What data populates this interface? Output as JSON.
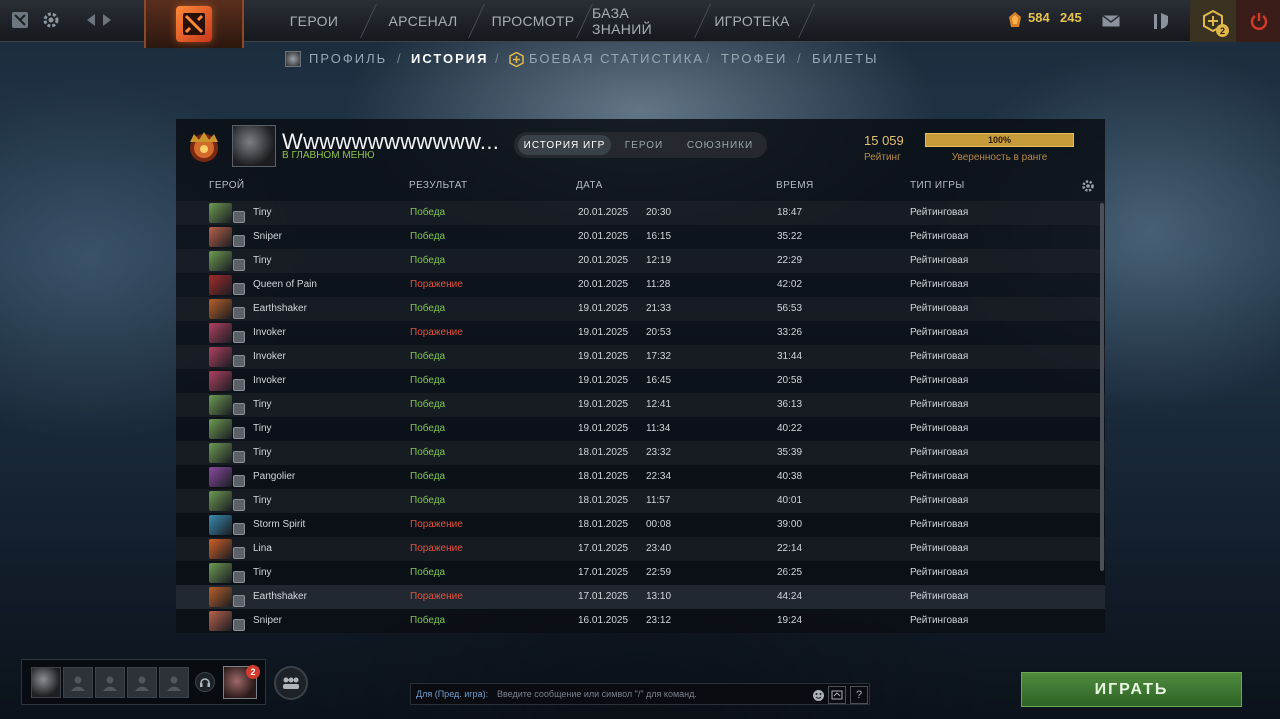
{
  "topbar": {
    "nav": [
      "ГЕРОИ",
      "АРСЕНАЛ",
      "ПРОСМОТР",
      "БАЗА ЗНАНИЙ",
      "ИГРОТЕКА"
    ],
    "currency_1": "584",
    "currency_2": "245",
    "notif_count": "2",
    "icons": [
      "dota-plus-icon",
      "settings-gear-icon",
      "back-arrow-icon",
      "forward-arrow-icon",
      "dota-logo-icon",
      "shards-icon",
      "mail-icon",
      "armory-icon",
      "battlepass-icon",
      "power-icon"
    ]
  },
  "subnav": {
    "items": [
      "ПРОФИЛЬ",
      "ИСТОРИЯ",
      "БОЕВАЯ СТАТИСТИКА",
      "ТРОФЕИ",
      "БИЛЕТЫ"
    ],
    "active": "ИСТОРИЯ",
    "separator": "/"
  },
  "profile": {
    "name": "Wwwwwwwwwwww...",
    "status": "В ГЛАВНОМ МЕНЮ",
    "rating": "15 059",
    "rating_label": "Рейтинг",
    "confidence": "100%",
    "confidence_level": 1.0,
    "confidence_label": "Уверенность в ранге"
  },
  "tabs": [
    "ИСТОРИЯ ИГР",
    "ГЕРОИ",
    "СОЮЗНИКИ"
  ],
  "table": {
    "headers": [
      "ГЕРОЙ",
      "РЕЗУЛЬТАТ",
      "ДАТА",
      "ВРЕМЯ",
      "ТИП ИГРЫ"
    ],
    "rows": [
      {
        "hero": "Tiny",
        "result": "Победа",
        "date": "20.01.2025",
        "time": "20:30",
        "duration": "18:47",
        "type": "Рейтинговая",
        "win": true,
        "color": "#6f9a52"
      },
      {
        "hero": "Sniper",
        "result": "Победа",
        "date": "20.01.2025",
        "time": "16:15",
        "duration": "35:22",
        "type": "Рейтинговая",
        "win": true,
        "color": "#b8624a"
      },
      {
        "hero": "Tiny",
        "result": "Победа",
        "date": "20.01.2025",
        "time": "12:19",
        "duration": "22:29",
        "type": "Рейтинговая",
        "win": true,
        "color": "#6f9a52"
      },
      {
        "hero": "Queen of Pain",
        "result": "Поражение",
        "date": "20.01.2025",
        "time": "11:28",
        "duration": "42:02",
        "type": "Рейтинговая",
        "win": false,
        "color": "#a32b2b"
      },
      {
        "hero": "Earthshaker",
        "result": "Победа",
        "date": "19.01.2025",
        "time": "21:33",
        "duration": "56:53",
        "type": "Рейтинговая",
        "win": true,
        "color": "#b8602a"
      },
      {
        "hero": "Invoker",
        "result": "Поражение",
        "date": "19.01.2025",
        "time": "20:53",
        "duration": "33:26",
        "type": "Рейтинговая",
        "win": false,
        "color": "#b04060"
      },
      {
        "hero": "Invoker",
        "result": "Победа",
        "date": "19.01.2025",
        "time": "17:32",
        "duration": "31:44",
        "type": "Рейтинговая",
        "win": true,
        "color": "#b04060"
      },
      {
        "hero": "Invoker",
        "result": "Победа",
        "date": "19.01.2025",
        "time": "16:45",
        "duration": "20:58",
        "type": "Рейтинговая",
        "win": true,
        "color": "#b04060"
      },
      {
        "hero": "Tiny",
        "result": "Победа",
        "date": "19.01.2025",
        "time": "12:41",
        "duration": "36:13",
        "type": "Рейтинговая",
        "win": true,
        "color": "#6f9a52"
      },
      {
        "hero": "Tiny",
        "result": "Победа",
        "date": "19.01.2025",
        "time": "11:34",
        "duration": "40:22",
        "type": "Рейтинговая",
        "win": true,
        "color": "#6f9a52"
      },
      {
        "hero": "Tiny",
        "result": "Победа",
        "date": "18.01.2025",
        "time": "23:32",
        "duration": "35:39",
        "type": "Рейтинговая",
        "win": true,
        "color": "#6f9a52"
      },
      {
        "hero": "Pangolier",
        "result": "Победа",
        "date": "18.01.2025",
        "time": "22:34",
        "duration": "40:38",
        "type": "Рейтинговая",
        "win": true,
        "color": "#8a4aa0"
      },
      {
        "hero": "Tiny",
        "result": "Победа",
        "date": "18.01.2025",
        "time": "11:57",
        "duration": "40:01",
        "type": "Рейтинговая",
        "win": true,
        "color": "#6f9a52"
      },
      {
        "hero": "Storm Spirit",
        "result": "Поражение",
        "date": "18.01.2025",
        "time": "00:08",
        "duration": "39:00",
        "type": "Рейтинговая",
        "win": false,
        "color": "#3a8ab0"
      },
      {
        "hero": "Lina",
        "result": "Поражение",
        "date": "17.01.2025",
        "time": "23:40",
        "duration": "22:14",
        "type": "Рейтинговая",
        "win": false,
        "color": "#d0602a"
      },
      {
        "hero": "Tiny",
        "result": "Победа",
        "date": "17.01.2025",
        "time": "22:59",
        "duration": "26:25",
        "type": "Рейтинговая",
        "win": true,
        "color": "#6f9a52"
      },
      {
        "hero": "Earthshaker",
        "result": "Поражение",
        "date": "17.01.2025",
        "time": "13:10",
        "duration": "44:24",
        "type": "Рейтинговая",
        "win": false,
        "color": "#b8602a"
      },
      {
        "hero": "Sniper",
        "result": "Победа",
        "date": "16.01.2025",
        "time": "23:12",
        "duration": "19:24",
        "type": "Рейтинговая",
        "win": true,
        "color": "#b8624a"
      }
    ]
  },
  "chat": {
    "channel": "Для (Пред. игра):",
    "placeholder": "Введите сообщение или символ \"/\" для команд."
  },
  "play_button": "ИГРАТЬ",
  "party_notif": "2"
}
